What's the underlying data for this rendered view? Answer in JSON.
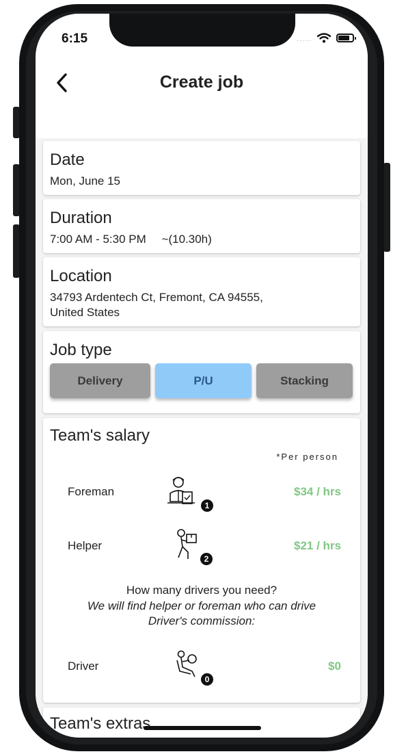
{
  "status_bar": {
    "time": "6:15",
    "signal": "....."
  },
  "nav": {
    "title": "Create job"
  },
  "date": {
    "label": "Date",
    "value": "Mon, June 15"
  },
  "duration": {
    "label": "Duration",
    "value": "7:00 AM - 5:30 PM",
    "hours": "~(10.30h)"
  },
  "location": {
    "label": "Location",
    "line1": "34793 Ardentech Ct, Fremont, CA  94555,",
    "line2": "United States"
  },
  "job_type": {
    "label": "Job type",
    "options": [
      {
        "label": "Delivery",
        "selected": false
      },
      {
        "label": "P/U",
        "selected": true
      },
      {
        "label": "Stacking",
        "selected": false
      }
    ]
  },
  "salary": {
    "label": "Team's salary",
    "per_person_note": "*Per person",
    "roles": [
      {
        "name": "Foreman",
        "icon": "foreman-icon",
        "count": "1",
        "rate": "$34 / hrs"
      },
      {
        "name": "Helper",
        "icon": "helper-mover-icon",
        "count": "2",
        "rate": "$21 / hrs"
      }
    ],
    "drivers_question": "How many drivers you need?",
    "drivers_note": "We will find helper or foreman who can drive",
    "commission_label": "Driver's commission:",
    "driver": {
      "name": "Driver",
      "icon": "driver-icon",
      "count": "0",
      "rate": "$0"
    }
  },
  "extras": {
    "label": "Team's extras"
  },
  "colors": {
    "accent_blue": "#90caf9",
    "rate_green": "#81c784",
    "button_gray": "#9e9e9e"
  }
}
